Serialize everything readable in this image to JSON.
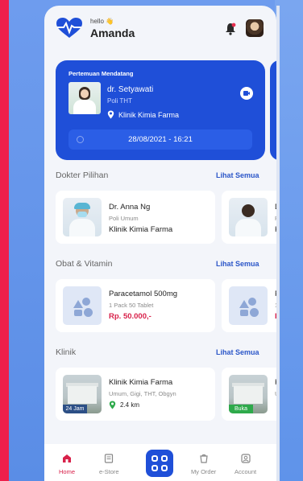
{
  "user": {
    "greeting": "hello 👋",
    "name": "Amanda"
  },
  "appointment": {
    "title": "Pertemuan Mendatang",
    "doctor": "dr. Setyawati",
    "poli": "Poli THT",
    "clinic": "Klinik Kimia Farma",
    "datetime": "28/08/2021 - 16:21"
  },
  "sections": {
    "doctors": {
      "title": "Dokter Pilihan",
      "see_all": "Lihat Semua"
    },
    "meds": {
      "title": "Obat & Vitamin",
      "see_all": "Lihat Semua"
    },
    "clinics": {
      "title": "Klinik",
      "see_all": "Lihat Semua"
    }
  },
  "doctor_card": {
    "name": "Dr. Anna Ng",
    "specialty": "Poli Umum",
    "clinic": "Klinik Kimia Farma"
  },
  "med_card": {
    "name": "Paracetamol 500mg",
    "pack": "1 Pack 50 Tablet",
    "price": "Rp. 50.000,-"
  },
  "clinic_card": {
    "name": "Klinik Kimia Farma",
    "services": "Umum, Gigi, THT, Obgyn",
    "distance": "2.4 km",
    "badge": "24 Jam",
    "peek_badge": "Buka"
  },
  "peek": {
    "doctor_initial": "D",
    "doctor_poli": "P",
    "doctor_clinic": "K",
    "med_initial": "P",
    "med_pack": "1",
    "med_price": "R",
    "clinic_initial": "K",
    "clinic_services": "U"
  },
  "nav": {
    "home": "Home",
    "estore": "e-Store",
    "order": "My Order",
    "account": "Account"
  },
  "colors": {
    "primary": "#1f4fd8",
    "accent": "#d8214a",
    "background": "#f3f5fa"
  }
}
